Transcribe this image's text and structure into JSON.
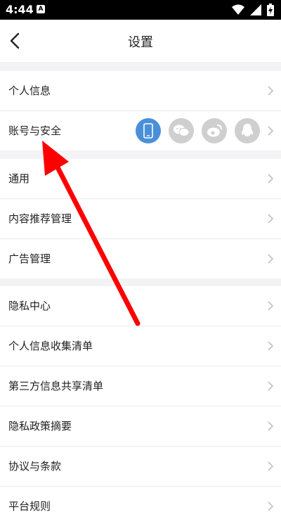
{
  "status_bar": {
    "time": "4:44",
    "notification_badge": "A",
    "icons": [
      "wifi-icon",
      "signal-icon",
      "battery-charging-icon"
    ]
  },
  "header": {
    "title": "设置",
    "back_icon": "chevron-left-icon"
  },
  "sections": [
    {
      "items": [
        {
          "label": "个人信息"
        },
        {
          "label": "账号与安全",
          "bindings": [
            "phone-icon",
            "wechat-icon",
            "weibo-icon",
            "qq-icon"
          ],
          "active_binding": "phone-icon"
        }
      ]
    },
    {
      "items": [
        {
          "label": "通用"
        },
        {
          "label": "内容推荐管理"
        },
        {
          "label": "广告管理"
        }
      ]
    },
    {
      "items": [
        {
          "label": "隐私中心"
        },
        {
          "label": "个人信息收集清单"
        },
        {
          "label": "第三方信息共享清单"
        },
        {
          "label": "隐私政策摘要"
        },
        {
          "label": "协议与条款"
        },
        {
          "label": "平台规则"
        }
      ]
    }
  ],
  "colors": {
    "active_binding": "#4a90d9",
    "inactive_binding": "#cfcfcf",
    "annotation_arrow": "#ff0000"
  }
}
